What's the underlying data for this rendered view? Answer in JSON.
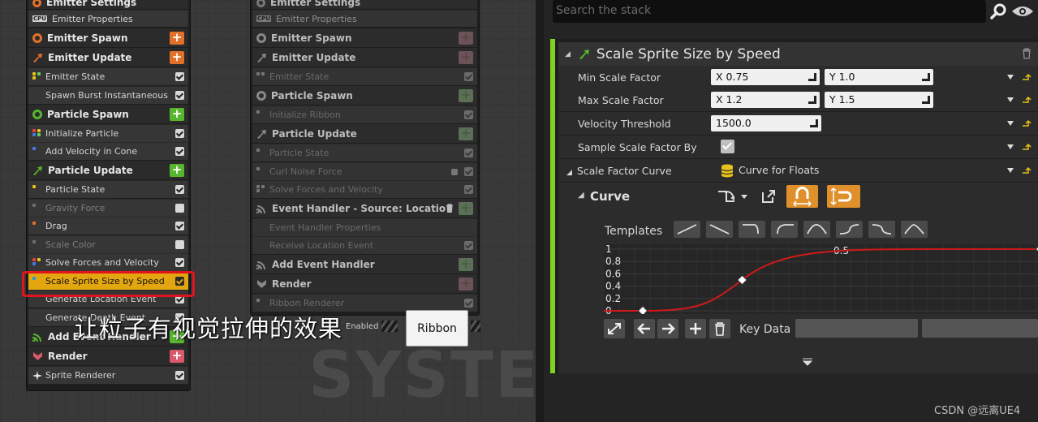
{
  "left_emitter": {
    "emitter_settings": "Emitter Settings",
    "emitter_properties": "Emitter Properties",
    "cpu_badge": "CPU",
    "emitter_spawn": "Emitter Spawn",
    "emitter_update": "Emitter Update",
    "emitter_state": "Emitter State",
    "spawn_burst": "Spawn Burst Instantaneous",
    "particle_spawn": "Particle Spawn",
    "initialize_particle": "Initialize Particle",
    "add_velocity_in_cone": "Add Velocity in Cone",
    "particle_update": "Particle Update",
    "particle_state": "Particle State",
    "gravity_force": "Gravity Force",
    "drag": "Drag",
    "scale_color": "Scale Color",
    "solve_forces": "Solve Forces and Velocity",
    "scale_sprite_size": "Scale Sprite Size by Speed",
    "generate_location_event": "Generate Location Event",
    "generate_death_event": "Generate Death Event",
    "add_event_handler": "Add Event Handler",
    "render": "Render",
    "sprite_renderer": "Sprite Renderer"
  },
  "mid_emitter": {
    "emitter_settings": "Emitter Settings",
    "emitter_properties": "Emitter Properties",
    "cpu_badge": "CPU",
    "emitter_spawn": "Emitter Spawn",
    "emitter_update": "Emitter Update",
    "emitter_state": "Emitter State",
    "particle_spawn": "Particle Spawn",
    "initialize_ribbon": "Initialize Ribbon",
    "particle_update": "Particle Update",
    "particle_state": "Particle State",
    "curl_noise_force": "Curl Noise Force",
    "solve_forces": "Solve Forces and Velocity",
    "event_handler": "Event Handler - Source: LocationEv",
    "event_handler_properties": "Event Handler Properties",
    "receive_location_event": "Receive Location Event",
    "add_event_handler": "Add Event Handler",
    "render": "Render",
    "ribbon_renderer": "Ribbon Renderer"
  },
  "overlay": {
    "caption": "让粒子有视觉拉伸的效果",
    "ribbon_button": "Ribbon",
    "enabled_tag": "Enabled",
    "system_watermark": "SYSTEM"
  },
  "stack_panel": {
    "search_placeholder": "Search the stack",
    "module_title": "Scale Sprite Size by Speed",
    "min_scale_label": "Min Scale Factor",
    "min_scale_x": "X 0.75",
    "min_scale_y": "Y 1.0",
    "max_scale_label": "Max Scale Factor",
    "max_scale_x": "X 1.2",
    "max_scale_y": "Y 1.5",
    "velocity_threshold_label": "Velocity Threshold",
    "velocity_threshold_value": "1500.0",
    "sample_scale_label": "Sample Scale Factor By Cu",
    "scale_factor_curve_label": "Scale Factor Curve",
    "curve_for_floats": "Curve for Floats",
    "curve_label": "Curve",
    "templates_label": "Templates",
    "key_data_label": "Key Data",
    "y_ticks": [
      "1",
      "0.8",
      "0.6",
      "0.4",
      "0.2",
      "0"
    ],
    "x_tick": "0.5"
  },
  "curve_keys": [
    {
      "t": 0.0,
      "v": 0.0
    },
    {
      "t": 0.25,
      "v": 0.5
    },
    {
      "t": 1.0,
      "v": 1.0
    }
  ],
  "colors": {
    "accent_orange": "#e0902a",
    "selected_module": "#e4a60f",
    "active_green": "#7fd320",
    "highlight_red": "#e1141b",
    "curve_red": "#d21919"
  },
  "watermark": "CSDN @远离UE4"
}
